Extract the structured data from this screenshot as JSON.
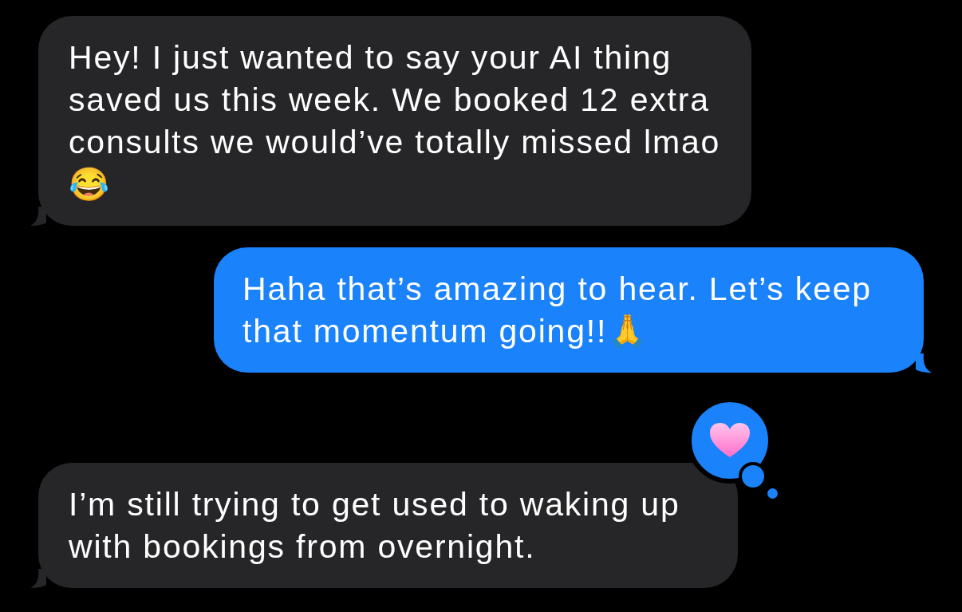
{
  "messages": [
    {
      "kind": "received",
      "text": "Hey! I just wanted to say your AI thing saved us this week. We booked 12 extra consults we would’ve totally missed lmao 😂"
    },
    {
      "kind": "sent",
      "text": "Haha that’s amazing to hear. Let’s keep that momentum going!!🙏"
    },
    {
      "kind": "received",
      "text": "I’m still trying to get used to waking up with bookings from overnight.",
      "reaction": {
        "kind": "heart"
      }
    }
  ]
}
